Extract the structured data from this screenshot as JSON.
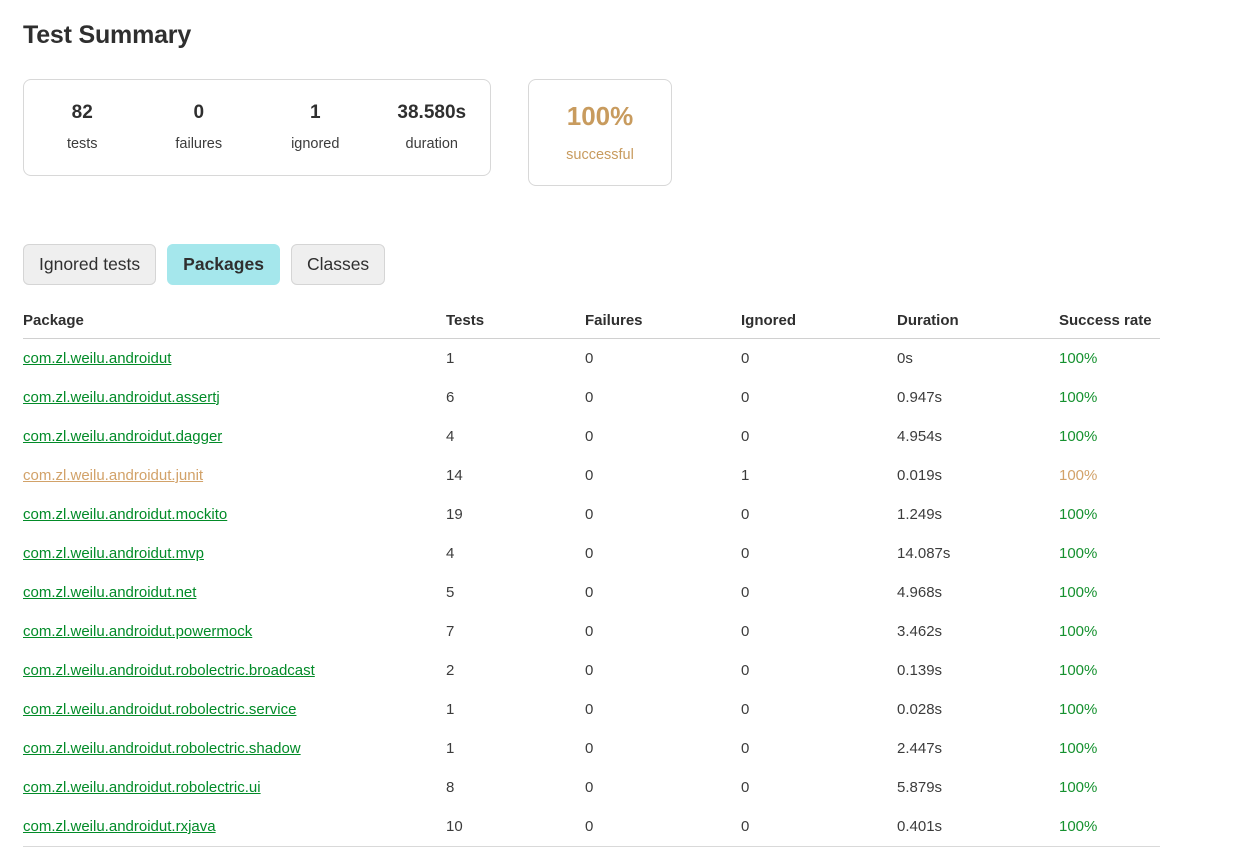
{
  "page": {
    "title": "Test Summary"
  },
  "summary": {
    "counters": [
      {
        "value": "82",
        "label": "tests"
      },
      {
        "value": "0",
        "label": "failures"
      },
      {
        "value": "1",
        "label": "ignored"
      },
      {
        "value": "38.580s",
        "label": "duration"
      }
    ],
    "success": {
      "value": "100%",
      "label": "successful",
      "color": "#c89b5e"
    }
  },
  "tabs": [
    {
      "label": "Ignored tests",
      "active": false
    },
    {
      "label": "Packages",
      "active": true
    },
    {
      "label": "Classes",
      "active": false
    }
  ],
  "table": {
    "headers": {
      "package": "Package",
      "tests": "Tests",
      "failures": "Failures",
      "ignored": "Ignored",
      "duration": "Duration",
      "success_rate": "Success rate"
    },
    "rows": [
      {
        "package": "com.zl.weilu.androidut",
        "tests": "1",
        "failures": "0",
        "ignored": "0",
        "duration": "0s",
        "success_rate": "100%",
        "status": "ok"
      },
      {
        "package": "com.zl.weilu.androidut.assertj",
        "tests": "6",
        "failures": "0",
        "ignored": "0",
        "duration": "0.947s",
        "success_rate": "100%",
        "status": "ok"
      },
      {
        "package": "com.zl.weilu.androidut.dagger",
        "tests": "4",
        "failures": "0",
        "ignored": "0",
        "duration": "4.954s",
        "success_rate": "100%",
        "status": "ok"
      },
      {
        "package": "com.zl.weilu.androidut.junit",
        "tests": "14",
        "failures": "0",
        "ignored": "1",
        "duration": "0.019s",
        "success_rate": "100%",
        "status": "warn"
      },
      {
        "package": "com.zl.weilu.androidut.mockito",
        "tests": "19",
        "failures": "0",
        "ignored": "0",
        "duration": "1.249s",
        "success_rate": "100%",
        "status": "ok"
      },
      {
        "package": "com.zl.weilu.androidut.mvp",
        "tests": "4",
        "failures": "0",
        "ignored": "0",
        "duration": "14.087s",
        "success_rate": "100%",
        "status": "ok"
      },
      {
        "package": "com.zl.weilu.androidut.net",
        "tests": "5",
        "failures": "0",
        "ignored": "0",
        "duration": "4.968s",
        "success_rate": "100%",
        "status": "ok"
      },
      {
        "package": "com.zl.weilu.androidut.powermock",
        "tests": "7",
        "failures": "0",
        "ignored": "0",
        "duration": "3.462s",
        "success_rate": "100%",
        "status": "ok"
      },
      {
        "package": "com.zl.weilu.androidut.robolectric.broadcast",
        "tests": "2",
        "failures": "0",
        "ignored": "0",
        "duration": "0.139s",
        "success_rate": "100%",
        "status": "ok"
      },
      {
        "package": "com.zl.weilu.androidut.robolectric.service",
        "tests": "1",
        "failures": "0",
        "ignored": "0",
        "duration": "0.028s",
        "success_rate": "100%",
        "status": "ok"
      },
      {
        "package": "com.zl.weilu.androidut.robolectric.shadow",
        "tests": "1",
        "failures": "0",
        "ignored": "0",
        "duration": "2.447s",
        "success_rate": "100%",
        "status": "ok"
      },
      {
        "package": "com.zl.weilu.androidut.robolectric.ui",
        "tests": "8",
        "failures": "0",
        "ignored": "0",
        "duration": "5.879s",
        "success_rate": "100%",
        "status": "ok"
      },
      {
        "package": "com.zl.weilu.androidut.rxjava",
        "tests": "10",
        "failures": "0",
        "ignored": "0",
        "duration": "0.401s",
        "success_rate": "100%",
        "status": "ok"
      }
    ]
  },
  "colors": {
    "link_ok": "#028b28",
    "link_warn": "#d2a269",
    "rate_ok": "#15912f",
    "rate_warn": "#d2a269",
    "tab_active_bg": "#a5e7ec",
    "tab_inactive_bg": "#efefef",
    "card_border": "#d8d8d8"
  }
}
